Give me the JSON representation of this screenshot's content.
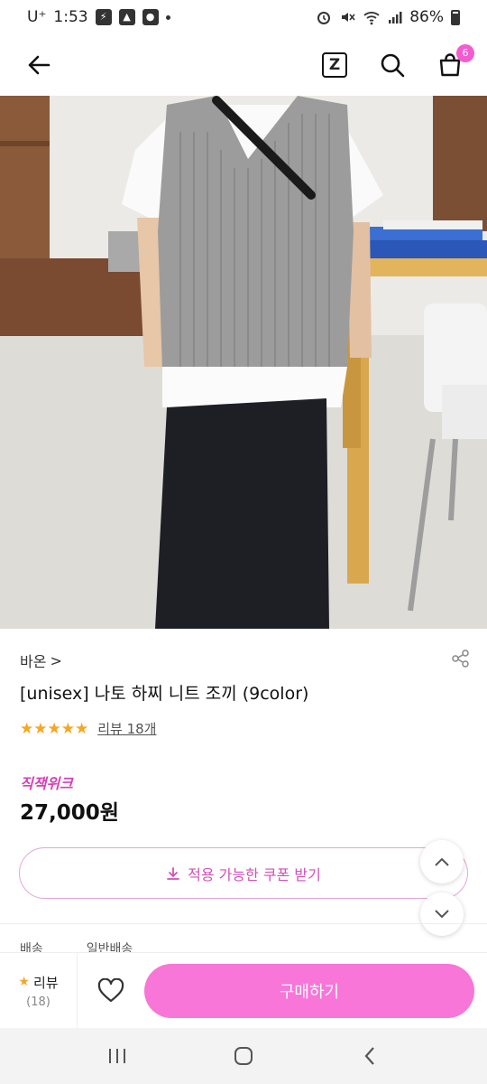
{
  "status_bar": {
    "carrier": "U⁺",
    "time": "1:53",
    "battery": "86%"
  },
  "header": {
    "back_icon": "arrow-left-icon",
    "z_label": "Z",
    "cart_count": "6"
  },
  "product": {
    "brand": "바온",
    "brand_chevron": ">",
    "title": "[unisex] 나토 하찌 니트 조끼 (9color)",
    "stars": "★★★★★",
    "review_link": "리뷰 18개",
    "promo_label": "직잭위크",
    "price": "27,000원"
  },
  "coupon": {
    "label": "적용 가능한 쿠폰 받기"
  },
  "shipping_peek": {
    "label": "배송",
    "value": "일반배송"
  },
  "action_bar": {
    "review_label": "리뷰",
    "review_count": "(18)",
    "buy_label": "구매하기"
  },
  "colors": {
    "accent_pink": "#f776d8",
    "promo_magenta": "#d63fb9",
    "star": "#f5a623"
  }
}
